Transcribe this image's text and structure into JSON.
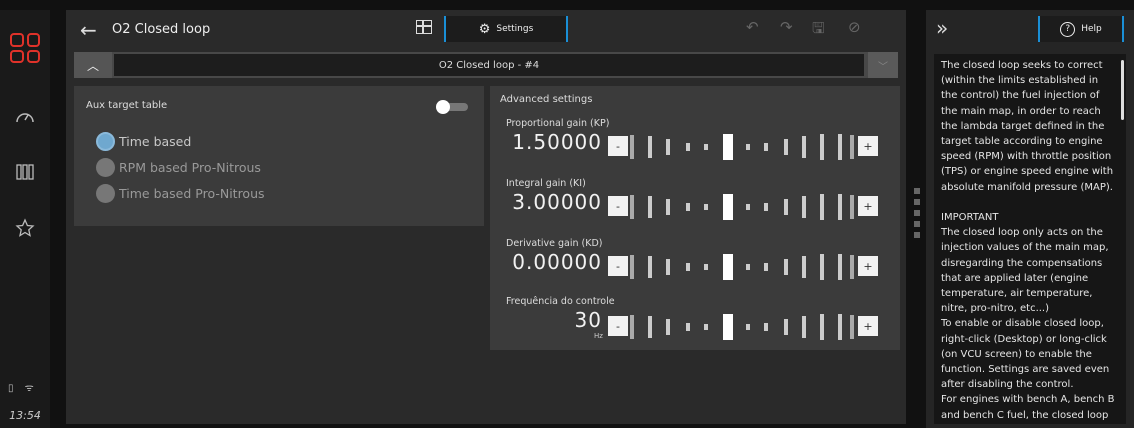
{
  "rail": {
    "time": "13:54",
    "status": "▯ ᯤ"
  },
  "header": {
    "back_glyph": "←",
    "title": "O2 Closed loop",
    "settings_tab": "Settings",
    "undo_glyph": "↶",
    "redo_glyph": "↷",
    "save_glyph": "🖫",
    "disable_glyph": "⊘"
  },
  "collapse": {
    "toggle_glyph": "︿",
    "title": "O2 Closed loop - #4",
    "right_glyph": "﹀"
  },
  "aux": {
    "label": "Aux target table",
    "toggle_on": false,
    "options": [
      "Time based",
      "RPM based Pro-Nitrous",
      "Time based Pro-Nitrous"
    ],
    "selected_index": 0
  },
  "advanced": {
    "title": "Advanced settings",
    "params": [
      {
        "label": "Proportional gain (KP)",
        "value": "1.50000",
        "unit": "",
        "minus": "-",
        "plus": "+"
      },
      {
        "label": "Integral gain (KI)",
        "value": "3.00000",
        "unit": "",
        "minus": "-",
        "plus": "+"
      },
      {
        "label": "Derivative gain (KD)",
        "value": "0.00000",
        "unit": "",
        "minus": "-",
        "plus": "+"
      },
      {
        "label": "Frequência do controle",
        "value": "30",
        "unit": "Hz",
        "minus": "-",
        "plus": "+"
      }
    ]
  },
  "help": {
    "chevron_glyph": "»",
    "button": "Help",
    "q_glyph": "?",
    "text": "The closed loop seeks to correct (within the limits established in the control) the fuel injection of the main map, in order to reach the lambda target defined in the target table according to engine speed (RPM) with throttle position (TPS) or engine speed engine with absolute manifold pressure (MAP).\n\nIMPORTANT\nThe closed loop only acts on the injection values of the main map, disregarding the compensations that are applied later (engine temperature, air temperature, nitre, pro-nitro, etc...)\nTo enable or disable closed loop, right-click (Desktop) or long-click (on VCU screen) to enable the function. Settings are saved even after disabling the control.\nFor engines with bench A, bench B and bench C fuel, the closed loop"
  }
}
